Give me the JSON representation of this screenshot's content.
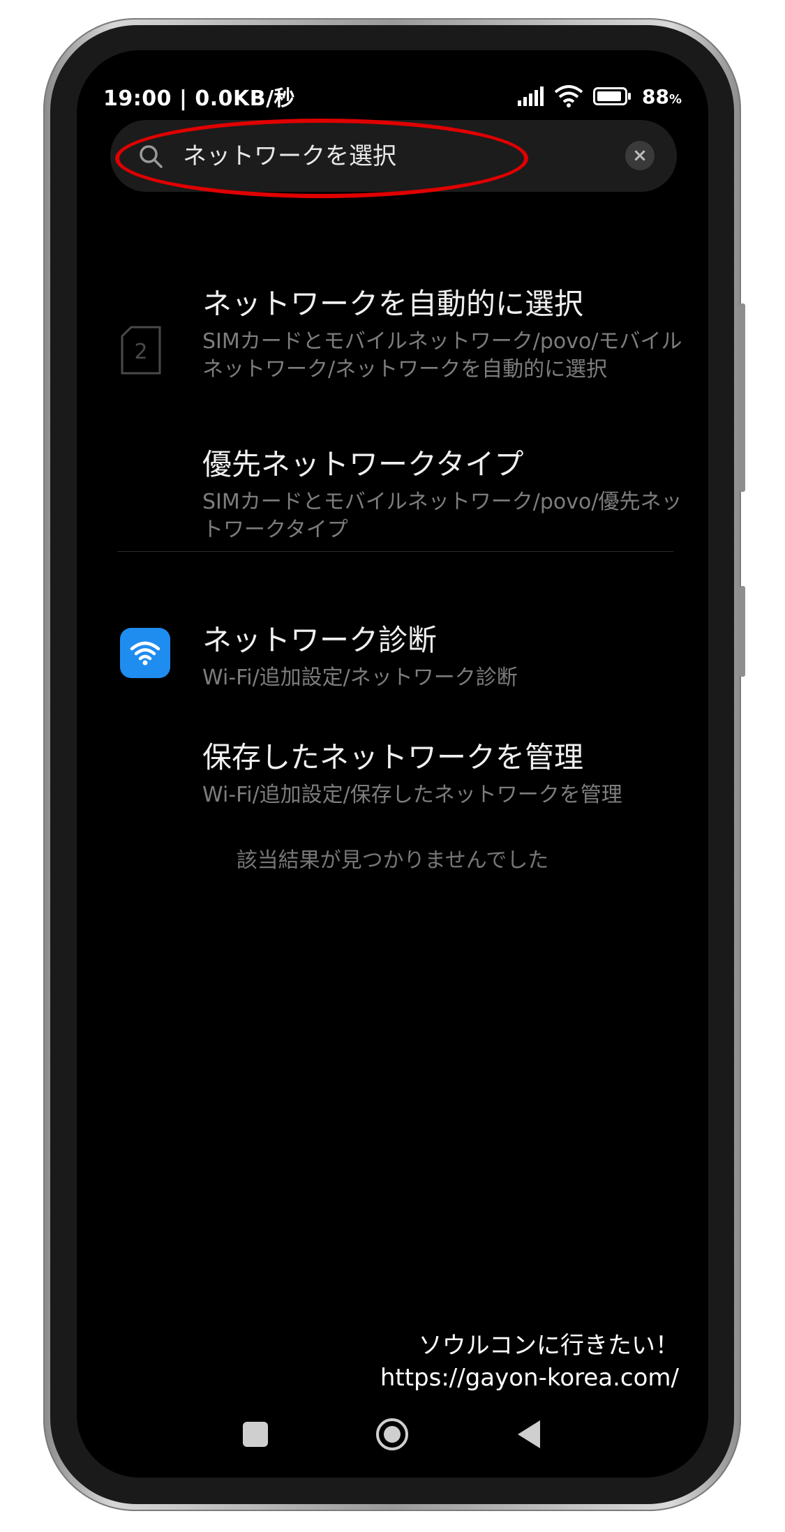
{
  "status_bar": {
    "time_speed": "19:00 | 0.0KB/秒",
    "battery_level": "88",
    "battery_unit": "%"
  },
  "search": {
    "query": "ネットワークを選択",
    "clear_symbol": "×"
  },
  "results": [
    {
      "title": "ネットワークを自動的に選択",
      "subtitle": "SIMカードとモバイルネットワーク/povo/モバイルネットワーク/ネットワークを自動的に選択",
      "icon": "sim-2-icon",
      "icon_text": "2"
    },
    {
      "title": "優先ネットワークタイプ",
      "subtitle": "SIMカードとモバイルネットワーク/povo/優先ネットワークタイプ"
    },
    {
      "title": "ネットワーク診断",
      "subtitle": "Wi-Fi/追加設定/ネットワーク診断",
      "icon": "wifi-icon"
    },
    {
      "title": "保存したネットワークを管理",
      "subtitle": "Wi-Fi/追加設定/保存したネットワークを管理"
    }
  ],
  "no_result_text": "該当結果が見つかりませんでした",
  "watermark": {
    "line1": "ソウルコンに行きたい！",
    "line2": "https://gayon-korea.com/"
  },
  "colors": {
    "highlight": "#e00000",
    "wifi_tile": "#1f8cf0",
    "background": "#000000"
  }
}
